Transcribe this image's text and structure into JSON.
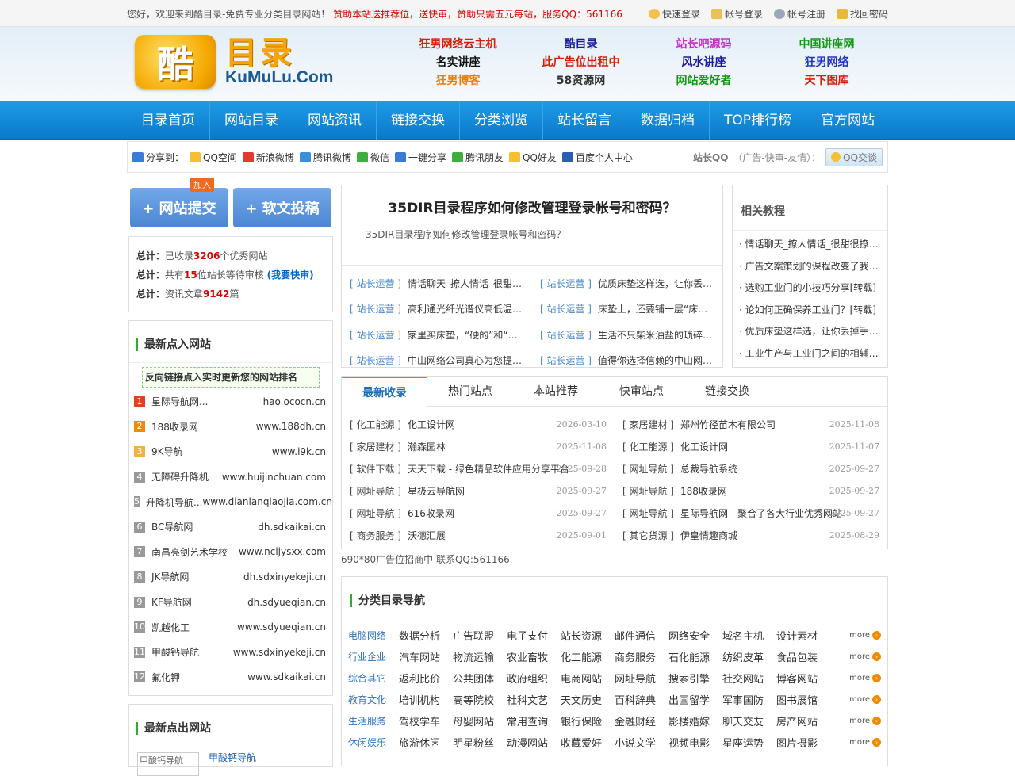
{
  "topbar": {
    "welcome_prefix": "您好，欢迎来到酷目录-免费专业分类目录网站！",
    "welcome_promo": "赞助本站送推荐位，送快审，赞助只需五元每站，服务QQ：561166",
    "links": [
      "快速登录",
      "帐号登录",
      "帐号注册",
      "找回密码"
    ]
  },
  "logo": {
    "cn": "目录",
    "badge": "酷",
    "en": "KuMuLu.Com"
  },
  "header_links": [
    {
      "text": "狂男网络云主机",
      "color": "#d81e06"
    },
    {
      "text": "酷目录",
      "color": "#1a1a9c"
    },
    {
      "text": "站长吧源码",
      "color": "#c82dd0"
    },
    {
      "text": "中国讲座网",
      "color": "#119a11"
    },
    {
      "text": "名实讲座",
      "color": "#111111"
    },
    {
      "text": "此广告位出租中",
      "color": "#d81e06"
    },
    {
      "text": "风水讲座",
      "color": "#1a1a9c"
    },
    {
      "text": "狂男网络",
      "color": "#2233c8"
    },
    {
      "text": "狂男博客",
      "color": "#f07c00"
    },
    {
      "text": "58资源网",
      "color": "#333333"
    },
    {
      "text": "网站爱好者",
      "color": "#119a11"
    },
    {
      "text": "天下图库",
      "color": "#d81e06"
    }
  ],
  "nav": [
    "目录首页",
    "网站目录",
    "网站资讯",
    "链接交换",
    "分类浏览",
    "站长留言",
    "数据归档",
    "TOP排行榜",
    "官方网站"
  ],
  "share": {
    "label": "分享到：",
    "items": [
      "QQ空间",
      "新浪微博",
      "腾讯微博",
      "微信",
      "一键分享",
      "腾讯朋友",
      "QQ好友",
      "百度个人中心"
    ],
    "qq_label": "站长QQ",
    "qq_note": "（广告-快审-友情）：",
    "qq_button": "QQ交谈"
  },
  "submit": {
    "site": "+ 网站提交",
    "article": "+ 软文投稿",
    "join_tag": "加入"
  },
  "stats": {
    "l1_label": "总计：",
    "l1_a": "已收录",
    "l1_num": "3206",
    "l1_b": "个优秀网站",
    "l2_label": "总计：",
    "l2_a": "共有",
    "l2_num": "15",
    "l2_b": "位站长等待审核",
    "l2_link": "(我要快审)",
    "l3_label": "总计：",
    "l3_a": "资讯文章",
    "l3_num": "9142",
    "l3_b": "篇"
  },
  "latest_in": {
    "title": "最新点入网站",
    "notice": "反向链接点入实时更新您的网站排名",
    "items": [
      {
        "n": "1",
        "name": "星际导航网...",
        "url": "hao.ococn.cn",
        "color": "#e0401c"
      },
      {
        "n": "2",
        "name": "188收录网",
        "url": "www.188dh.cn",
        "color": "#f08a00"
      },
      {
        "n": "3",
        "name": "9K导航",
        "url": "www.i9k.cn",
        "color": "#f5b042"
      },
      {
        "n": "4",
        "name": "无障碍升降机",
        "url": "www.huijinchuan.com",
        "color": "#999999"
      },
      {
        "n": "5",
        "name": "升降机导航...",
        "url": "www.dianlanqiaojia.com.cn",
        "color": "#999999"
      },
      {
        "n": "6",
        "name": "BC导航网",
        "url": "dh.sdkaikai.cn",
        "color": "#999999"
      },
      {
        "n": "7",
        "name": "南昌亮剑艺术学校",
        "url": "www.ncljysxx.com",
        "color": "#999999"
      },
      {
        "n": "8",
        "name": "JK导航网",
        "url": "dh.sdxinyekeji.cn",
        "color": "#999999"
      },
      {
        "n": "9",
        "name": "KF导航网",
        "url": "dh.sdyueqian.cn",
        "color": "#999999"
      },
      {
        "n": "10",
        "name": "凯越化工",
        "url": "www.sdyueqian.cn",
        "color": "#999999"
      },
      {
        "n": "11",
        "name": "甲酸钙导航",
        "url": "www.sdxinyekeji.cn",
        "color": "#999999"
      },
      {
        "n": "12",
        "name": "氟化钾",
        "url": "www.sdkaikai.cn",
        "color": "#999999"
      }
    ]
  },
  "latest_out": {
    "title": "最新点出网站",
    "thumb_alt": "甲酸钙导航",
    "first_name": "甲酸钙导航"
  },
  "article": {
    "title": "35DIR目录程序如何修改管理登录帐号和密码？",
    "summary": "35DIR目录程序如何修改管理登录帐号和密码？",
    "related": [
      {
        "cat": "[ 站长运营 ]",
        "title": "情话聊天_撩人情话_很甜很撩人的情话"
      },
      {
        "cat": "[ 站长运营 ]",
        "title": "优质床垫这样选，让你丢掉手机好好睡"
      },
      {
        "cat": "[ 站长运营 ]",
        "title": "高利通光纤光谱仪高低温测试方案"
      },
      {
        "cat": "[ 站长运营 ]",
        "title": "床垫上，还要铺一层“床褥”吗？"
      },
      {
        "cat": "[ 站长运营 ]",
        "title": "家里买床垫，“硬的”和“软的”哪个好"
      },
      {
        "cat": "[ 站长运营 ]",
        "title": "生活不只柴米油盐的琐碎，还有诗和远方"
      },
      {
        "cat": "[ 站长运营 ]",
        "title": "中山网络公司真心为您提供优质服务"
      },
      {
        "cat": "[ 站长运营 ]",
        "title": "值得你选择信赖的中山网络公司"
      }
    ]
  },
  "tutorials": {
    "title": "相关教程",
    "items": [
      "· 情话聊天_撩人情话_很甜很撩人的情话",
      "· 广告文案策划的课程改变了我的生活",
      "· 选购工业门的小技巧分享[转载]",
      "· 论如何正确保养工业门？[转载]",
      "· 优质床垫这样选，让你丢掉手机好好睡",
      "· 工业生产与工业门之间的相辅相成关系"
    ]
  },
  "tabs": {
    "items": [
      "最新收录",
      "热门站点",
      "本站推荐",
      "快审站点",
      "链接交换"
    ],
    "active": 0,
    "entries": [
      {
        "cat": "[ 化工能源 ]",
        "title": "化工设计网",
        "date": "2026-03-10"
      },
      {
        "cat": "[ 家居建材 ]",
        "title": "郑州竹径苗木有限公司",
        "date": "2025-11-08"
      },
      {
        "cat": "[ 家居建材 ]",
        "title": "瀚森园林",
        "date": "2025-11-08"
      },
      {
        "cat": "[ 化工能源 ]",
        "title": "化工设计网",
        "date": "2025-11-07"
      },
      {
        "cat": "[ 软件下载 ]",
        "title": "天天下载 - 绿色精品软件应用分享平台",
        "date": "2025-09-28"
      },
      {
        "cat": "[ 网址导航 ]",
        "title": "总裁导航系统",
        "date": "2025-09-27"
      },
      {
        "cat": "[ 网址导航 ]",
        "title": "星极云导航网",
        "date": "2025-09-27"
      },
      {
        "cat": "[ 网址导航 ]",
        "title": "188收录网",
        "date": "2025-09-27"
      },
      {
        "cat": "[ 网址导航 ]",
        "title": "616收录网",
        "date": "2025-09-27"
      },
      {
        "cat": "[ 网址导航 ]",
        "title": "星际导航网 - 聚合了各大行业优秀网站",
        "date": "2025-09-27"
      },
      {
        "cat": "[ 商务服务 ]",
        "title": "沃德汇展",
        "date": "2025-09-01"
      },
      {
        "cat": "[ 其它货源 ]",
        "title": "伊皇情趣商城",
        "date": "2025-08-29"
      }
    ]
  },
  "ad_text": "690*80广告位招商中 联系QQ:561166",
  "categories": {
    "title": "分类目录导航",
    "more": "more",
    "rows": [
      {
        "head": "电脑网络",
        "subs": [
          "数据分析",
          "广告联盟",
          "电子支付",
          "站长资源",
          "邮件通信",
          "网络安全",
          "域名主机",
          "设计素材"
        ]
      },
      {
        "head": "行业企业",
        "subs": [
          "汽车网站",
          "物流运输",
          "农业畜牧",
          "化工能源",
          "商务服务",
          "石化能源",
          "纺织皮革",
          "食品包装"
        ]
      },
      {
        "head": "综合其它",
        "subs": [
          "返利比价",
          "公共团体",
          "政府组织",
          "电商网站",
          "网址导航",
          "搜索引擎",
          "社交网站",
          "博客网站"
        ]
      },
      {
        "head": "教育文化",
        "subs": [
          "培训机构",
          "高等院校",
          "社科文艺",
          "天文历史",
          "百科辞典",
          "出国留学",
          "军事国防",
          "图书展馆"
        ]
      },
      {
        "head": "生活服务",
        "subs": [
          "驾校学车",
          "母婴网站",
          "常用查询",
          "银行保险",
          "金融财经",
          "影楼婚嫁",
          "聊天交友",
          "房产网站"
        ]
      },
      {
        "head": "休闲娱乐",
        "subs": [
          "旅游休闲",
          "明星粉丝",
          "动漫网站",
          "收藏爱好",
          "小说文学",
          "视频电影",
          "星座运势",
          "图片摄影"
        ]
      }
    ]
  }
}
